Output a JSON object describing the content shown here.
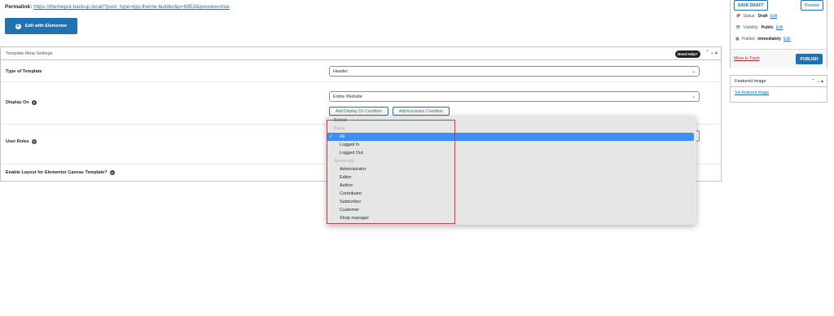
{
  "permalink": {
    "label": "Permalink:",
    "url": "https://themepul-backup.local/?post_type=tpp-theme-builder&p=6853&preview=true"
  },
  "elementor_button": {
    "label": "Edit with Elementor",
    "logo": "E"
  },
  "metabox": {
    "title": "Template Meta Settings",
    "need_help": "Need Help?",
    "arrows": "⌃⌄▴",
    "rows": {
      "type_of_template": {
        "label": "Type of Template",
        "value": "Header"
      },
      "display_on": {
        "label": "Display On",
        "value": "Entire Website",
        "add_display_condition": "Add Display On Condition",
        "add_exclusion_condition": "Add Exclusion Condition"
      },
      "user_roles": {
        "label": "User Roles"
      },
      "enable_layout": {
        "label": "Enable Layout for Elementor Canvas Template?"
      }
    },
    "help_icon": "?"
  },
  "publish": {
    "save_draft": "SAVE DRAFT",
    "preview": "Preview",
    "status_label": "Status:",
    "status_value": "Draft",
    "visibility_label": "Visibility:",
    "visibility_value": "Public",
    "publish_label": "Publish",
    "publish_value": "immediately",
    "edit": "Edit",
    "move_to_trash": "Move to Trash",
    "publish_button": "PUBLISH"
  },
  "featured_image": {
    "title": "Featured image",
    "arrows": "⌃⌄▴",
    "link": "Set featured image"
  },
  "user_roles_dropdown": {
    "placeholder": "Select",
    "group_basic": "Basic",
    "selected": "All",
    "basic_options": [
      "All",
      "Logged In",
      "Logged Out"
    ],
    "group_advanced": "Advanced",
    "advanced_options": [
      "Administrator",
      "Editor",
      "Author",
      "Contributor",
      "Subscriber",
      "Customer",
      "Shop manager"
    ]
  },
  "colors": {
    "accent": "#2271b1",
    "highlight": "#d9363e",
    "selected_option": "#3d8ef5",
    "trash": "#b32d2e"
  }
}
